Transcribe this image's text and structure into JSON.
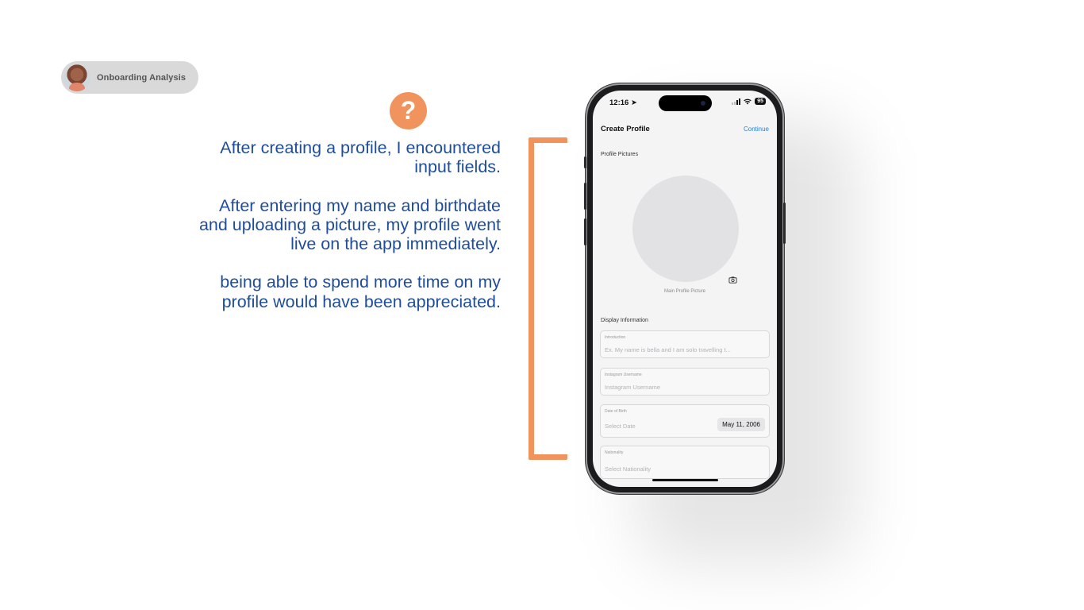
{
  "badge": {
    "label": "Onboarding Analysis"
  },
  "question_mark": "?",
  "notes": [
    "After creating a profile, I encountered input fields.",
    "After entering my name and birthdate and uploading a picture, my profile went live on the app immediately.",
    "being able to spend more time on my profile would have been appreciated."
  ],
  "colors": {
    "accent": "#f0935d",
    "text_blue": "#1f4d9c",
    "link_blue": "#2a7fd3"
  },
  "phone": {
    "status": {
      "time": "12:16",
      "battery": "95"
    },
    "nav": {
      "title": "Create Profile",
      "continue": "Continue"
    },
    "profile_pictures": {
      "section_label": "Profile Pictures",
      "caption": "Main Profile Picture",
      "icon": "camera-icon"
    },
    "display_info": {
      "section_label": "Display Information",
      "introduction": {
        "label": "Introduction",
        "placeholder": "Ex. My name is bella and I am solo travelling t..."
      },
      "instagram": {
        "label": "Instagram Username",
        "placeholder": "Instagram Username"
      },
      "dob": {
        "label": "Date of Birth",
        "placeholder": "Select Date",
        "value": "May 11, 2006"
      },
      "nationality": {
        "label": "Nationality",
        "placeholder": "Select Nationality"
      }
    }
  }
}
